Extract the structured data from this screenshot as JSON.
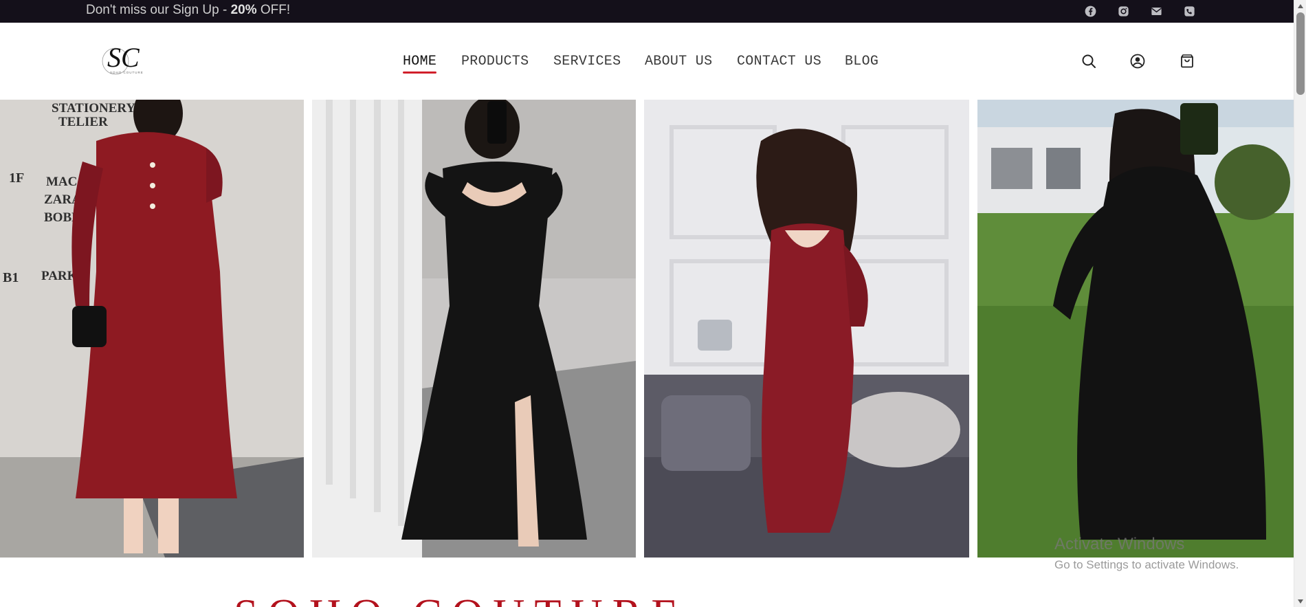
{
  "topbar": {
    "promo_prefix": "Don't miss our Sign Up - ",
    "promo_highlight": "20%",
    "promo_suffix": " OFF!",
    "social_icons": [
      "facebook-icon",
      "instagram-icon",
      "mail-icon",
      "phone-icon"
    ]
  },
  "header": {
    "logo_text": "SC",
    "logo_subtext": "SOHO COUTURE",
    "nav": [
      {
        "label": "HOME",
        "active": true
      },
      {
        "label": "PRODUCTS",
        "active": false
      },
      {
        "label": "SERVICES",
        "active": false
      },
      {
        "label": "ABOUT US",
        "active": false
      },
      {
        "label": "CONTACT US",
        "active": false
      },
      {
        "label": "BLOG",
        "active": false
      }
    ],
    "icons": [
      "search-icon",
      "account-icon",
      "cart-icon"
    ]
  },
  "gallery": {
    "items": [
      {
        "name": "red-ruffle-midi-dress",
        "dress_color": "#8e1a22"
      },
      {
        "name": "black-puff-sleeve-slit-dress",
        "dress_color": "#141414"
      },
      {
        "name": "red-ruched-bodycon-dress",
        "dress_color": "#8a1b26"
      },
      {
        "name": "black-long-sleeve-maxi-dress",
        "dress_color": "#121212"
      }
    ],
    "sign_text": [
      "STATIONERY",
      "TELIER",
      "1F",
      "MAC",
      "ZARA",
      "BOBBI",
      "B1",
      "PARK N"
    ]
  },
  "section_heading_partial": "SOHO COUTURE",
  "watermark": {
    "title": "Activate Windows",
    "subtitle": "Go to Settings to activate Windows."
  },
  "colors": {
    "topbar_bg": "#14101a",
    "accent_red": "#d11f2b",
    "heading_red": "#b3121d"
  }
}
